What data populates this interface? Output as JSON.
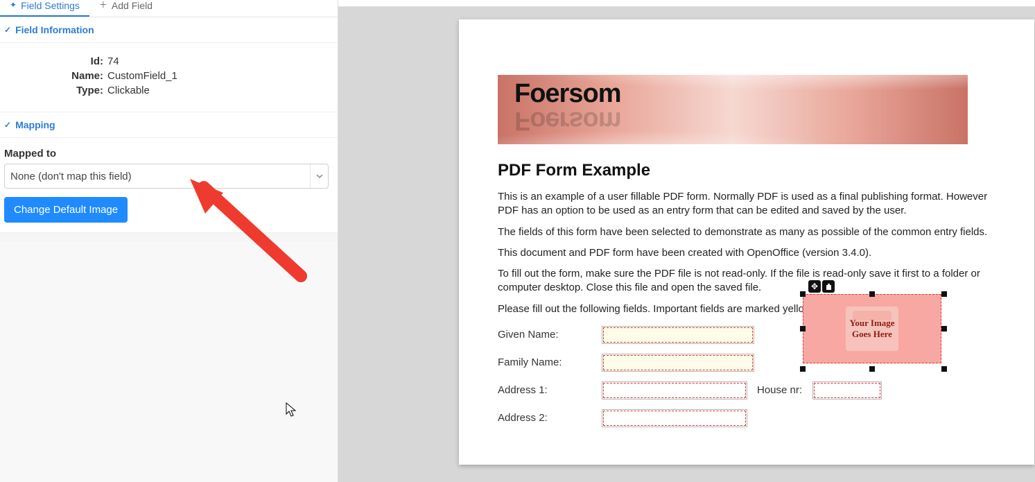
{
  "tabs": {
    "settings": {
      "label": "Field Settings"
    },
    "add": {
      "label": "Add Field"
    }
  },
  "sections": {
    "field_info": {
      "title": "Field Information"
    },
    "mapping": {
      "title": "Mapping"
    }
  },
  "field": {
    "id_label": "Id:",
    "id_value": "74",
    "name_label": "Name:",
    "name_value": "CustomField_1",
    "type_label": "Type:",
    "type_value": "Clickable"
  },
  "mapping": {
    "mapped_to_label": "Mapped to",
    "select_value": "None (don't map this field)",
    "change_image_btn": "Change Default Image"
  },
  "doc": {
    "brand": "Foersom",
    "h2": "PDF Form Example",
    "p1": "This is an example of a user fillable PDF form. Normally PDF is used as a final publishing format. However PDF has an option to be used as an entry form that can be edited and saved by the user.",
    "p2": "The fields of this form have been selected to demonstrate as many as possible of the common entry fields.",
    "p3": "This document and PDF form have been created with OpenOffice (version 3.4.0).",
    "p4": "To fill out the form, make sure the PDF file is not read-only. If the file is read-only save it first to a folder or computer desktop. Close this file and open the saved file.",
    "p5": "Please fill out the following fields. Important fields are marked yellow.",
    "labels": {
      "given": "Given Name:",
      "family": "Family Name:",
      "addr1": "Address 1:",
      "addr2": "Address 2:",
      "house": "House nr:"
    },
    "image_widget": {
      "line1": "Your Image",
      "line2": "Goes Here"
    }
  }
}
